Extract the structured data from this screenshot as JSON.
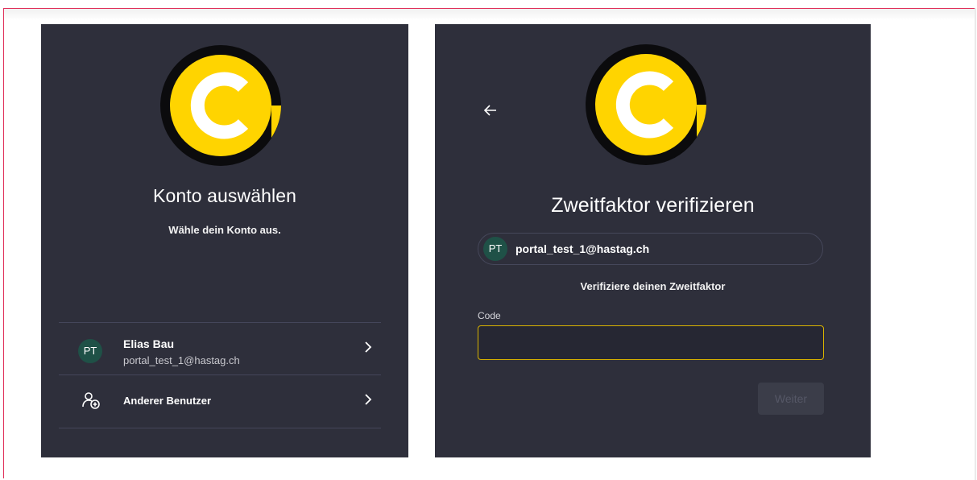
{
  "left_panel": {
    "title": "Konto auswählen",
    "subtitle": "Wähle dein Konto aus.",
    "accounts": [
      {
        "initials": "PT",
        "name": "Elias Bau",
        "email": "portal_test_1@hastag.ch"
      }
    ],
    "other_user_label": "Anderer Benutzer"
  },
  "right_panel": {
    "title": "Zweitfaktor verifizieren",
    "user_initials": "PT",
    "user_email": "portal_test_1@hastag.ch",
    "subtitle": "Verifiziere deinen Zweitfaktor",
    "code_label": "Code",
    "code_value": "",
    "next_button": "Weiter"
  },
  "colors": {
    "panel_bg": "#2e2f3b",
    "logo_yellow": "#ffd400",
    "avatar_bg": "#1f5147",
    "input_focus_border": "#d8b200"
  },
  "icons": {
    "back": "arrow-left-icon",
    "chevron": "chevron-right-icon",
    "add_user": "user-add-icon",
    "logo": "brand-logo-icon"
  }
}
